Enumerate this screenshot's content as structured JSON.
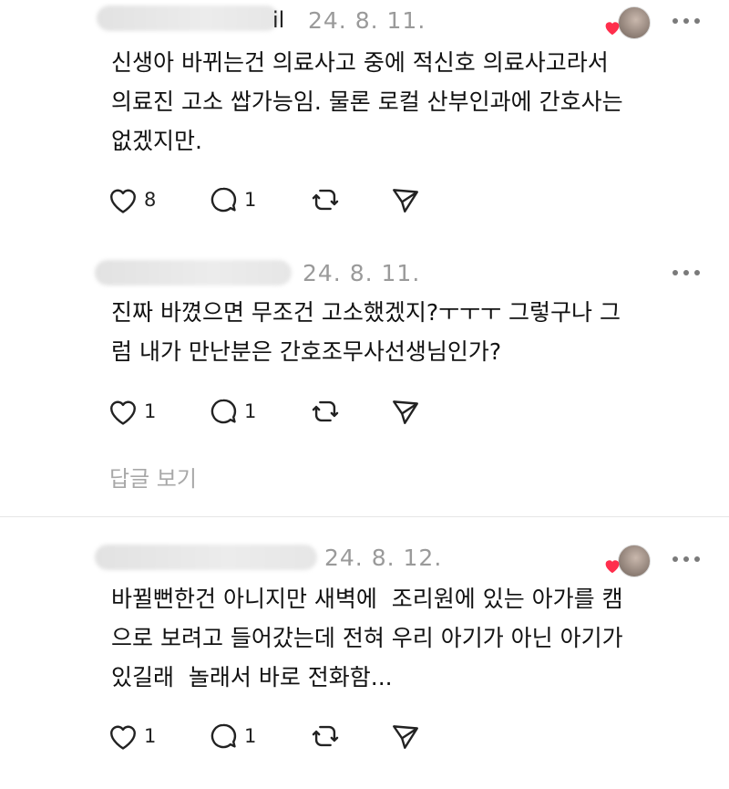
{
  "posts": [
    {
      "author_tail": "il",
      "date": "24. 8. 11.",
      "text": "신생아 바뀌는건 의료사고 중에 적신호 의료사고라서\n의료진 고소 쌉가능임. 물론 로컬 산부인과에 간호사는\n없겠지만.",
      "likes": "8",
      "replies": "1",
      "author_liked": true
    },
    {
      "author_tail": "",
      "date": "24. 8. 11.",
      "text": "진짜 바꼈으면 무조건 고소했겠지?ㅜㅜㅜ 그렇구나 그\n럼 내가 만난분은 간호조무사선생님인가?",
      "likes": "1",
      "replies": "1",
      "author_liked": false
    },
    {
      "author_tail": "",
      "date": "24. 8. 12.",
      "text": "바뀔뻔한건 아니지만 새벽에  조리원에 있는 아가를 캠\n으로 보려고 들어갔는데 전혀 우리 아기가 아닌 아기가\n있길래  놀래서 바로 전화함...",
      "likes": "1",
      "replies": "1",
      "author_liked": true
    }
  ],
  "view_replies_label": "답글 보기",
  "icons": {
    "like": "heart-outline-icon",
    "reply": "speech-bubble-icon",
    "repost": "repost-icon",
    "share": "send-icon",
    "more": "more-dots-icon"
  },
  "colors": {
    "date": "#9a9a9a",
    "muted_link": "#a8a8a8",
    "liked_heart": "#ff2e4c"
  }
}
